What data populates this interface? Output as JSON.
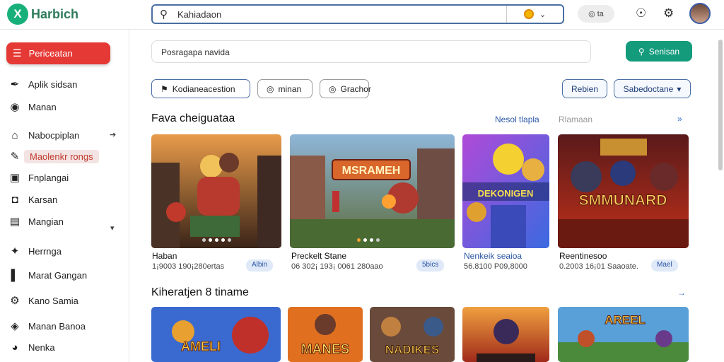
{
  "app": {
    "logo_mark": "X",
    "name": "Harbich"
  },
  "search": {
    "text": "Kahiadaon",
    "pill": "◎ ta"
  },
  "sidebar": {
    "active": "Periceatan",
    "items": [
      {
        "label": "Aplik sidsan",
        "icon": "✒"
      },
      {
        "label": "Manan",
        "icon": "◉"
      },
      {
        "label": "Nabocpiplan",
        "icon": "⌂"
      },
      {
        "label": "Maolenkr rongs",
        "icon": "✎"
      },
      {
        "label": "Fnplangai",
        "icon": "▣"
      },
      {
        "label": "Karsan",
        "icon": "◘"
      },
      {
        "label": "Mangian",
        "icon": "▤"
      },
      {
        "label": "Herrnga",
        "icon": "✦"
      },
      {
        "label": "Marat Gangan",
        "icon": "▌"
      },
      {
        "label": "Kano Samia",
        "icon": "⚙"
      },
      {
        "label": "Manan Banoa",
        "icon": "◈"
      },
      {
        "label": "Nenka",
        "icon": "◕"
      }
    ]
  },
  "main": {
    "search_text": "Posragapa navida",
    "search_button": "Senisan",
    "chips": [
      {
        "label": "Kodianeacestion",
        "icon": "⚑"
      },
      {
        "label": "minan",
        "icon": "◎"
      },
      {
        "label": "Grachor",
        "icon": "◎"
      }
    ],
    "refresh_button": "Rebien",
    "sort_select": "Sabedoctane"
  },
  "section1": {
    "title": "Fava cheiguataa",
    "link1": "Nesol tlapla",
    "link2": "Rlamaan",
    "arrow": "»",
    "cards": [
      {
        "title": "Haban",
        "meta": "1¡9003 190¡280ertas",
        "badge": "Albin",
        "art_text": ""
      },
      {
        "title": "Preckelt Stane",
        "meta": "06 302¡ 193¡ 0061 280aao",
        "badge": "5bics",
        "art_text": "MSRAMEH"
      },
      {
        "title": "Nenkeik seaioa",
        "meta": "56.8100 P09,8000",
        "badge": "",
        "art_text": "DEKONIGEN"
      },
      {
        "title": "Reentinesoo",
        "meta": "0.2003 16¡01 Saaoate.",
        "badge": "Mael",
        "art_text": "SMMUNARD"
      }
    ]
  },
  "section2": {
    "title": "Kiheratjen 8 tiname",
    "arrow": "→",
    "cards": [
      {
        "art_text": "AMELI"
      },
      {
        "art_text": "MANES"
      },
      {
        "art_text": "NADIKES"
      },
      {
        "art_text": ""
      },
      {
        "art_text": "AREEL"
      }
    ]
  }
}
